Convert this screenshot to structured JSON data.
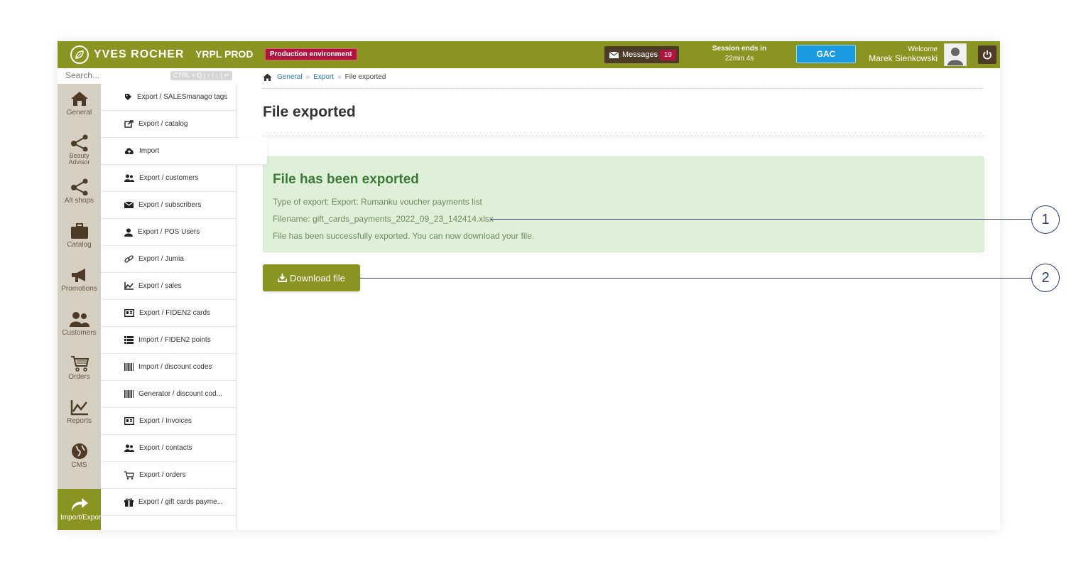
{
  "colors": {
    "topbar": "#8a9420",
    "sidebar": "#d7cfc1",
    "badge": "#b3123d",
    "gac": "#1a9ae0",
    "success_bg": "#dff0d8",
    "callout": "#2d3e79"
  },
  "header": {
    "brand": "YVES ROCHER",
    "instance": "YRPL PROD",
    "env_badge": "Production environment",
    "messages_label": "Messages",
    "messages_count": "19",
    "session_line1": "Session ends in",
    "session_line2": "22min 4s",
    "gac_label": "GAC",
    "welcome": "Welcome",
    "user_name": "Marek Sienkowski",
    "icons": {
      "messages": "envelope-icon",
      "avatar": "user-avatar-icon",
      "logout": "power-icon"
    }
  },
  "search": {
    "placeholder": "Search...",
    "hint": "CTRL + Q | ↑ / ↓ | ↵"
  },
  "sidebar": {
    "items": [
      {
        "label": "General",
        "icon": "home-icon"
      },
      {
        "label": "Beauty Advisor",
        "icon": "share-nodes-icon"
      },
      {
        "label": "Alt shops",
        "icon": "share-nodes-icon"
      },
      {
        "label": "Catalog",
        "icon": "briefcase-icon"
      },
      {
        "label": "Promotions",
        "icon": "megaphone-icon"
      },
      {
        "label": "Customers",
        "icon": "users-icon"
      },
      {
        "label": "Orders",
        "icon": "cart-icon"
      },
      {
        "label": "Reports",
        "icon": "chart-icon"
      },
      {
        "label": "CMS",
        "icon": "globe-icon"
      },
      {
        "label": "Import/Export",
        "icon": "share-arrow-icon"
      }
    ]
  },
  "submenu": {
    "items": [
      {
        "label": "Export / SALESmanago tags",
        "icon": "tag-icon"
      },
      {
        "label": "Export / catalog",
        "icon": "external-link-icon"
      },
      {
        "label": "Import",
        "icon": "cloud-upload-icon"
      },
      {
        "label": "Export / customers",
        "icon": "users-icon"
      },
      {
        "label": "Export / subscribers",
        "icon": "envelope-icon"
      },
      {
        "label": "Export / POS Users",
        "icon": "user-icon"
      },
      {
        "label": "Export / Jumia",
        "icon": "link-icon"
      },
      {
        "label": "Export / sales",
        "icon": "chart-icon"
      },
      {
        "label": "Export / FIDEN2 cards",
        "icon": "id-card-icon"
      },
      {
        "label": "Import / FIDEN2 points",
        "icon": "list-icon"
      },
      {
        "label": "Import / discount codes",
        "icon": "barcode-icon"
      },
      {
        "label": "Generator / discount cod...",
        "icon": "barcode-icon"
      },
      {
        "label": "Export / Invoices",
        "icon": "id-card-icon"
      },
      {
        "label": "Export / contacts",
        "icon": "users-icon"
      },
      {
        "label": "Export / orders",
        "icon": "cart-icon"
      },
      {
        "label": "Export / gift cards payme...",
        "icon": "gift-icon"
      }
    ]
  },
  "breadcrumb": {
    "home_icon": "home-icon",
    "items": [
      "General",
      "Export",
      "File exported"
    ],
    "separator": "»"
  },
  "main": {
    "title": "File exported",
    "alert": {
      "title": "File has been exported",
      "type_line": "Type of export: Export: Rumanku voucher payments list",
      "filename_line": "Filename: gift_cards_payments_2022_09_23_142414.xlsx",
      "message": "File has been successfully exported. You can now download your file."
    },
    "download_label": "Download file"
  },
  "callouts": [
    "1",
    "2"
  ]
}
